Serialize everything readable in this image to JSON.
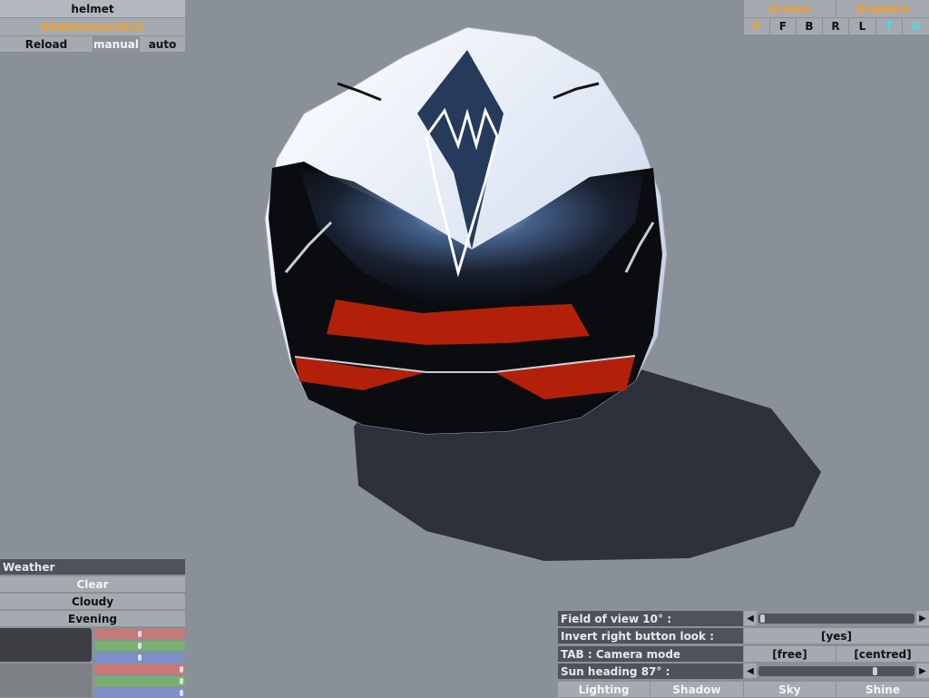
{
  "top_left": {
    "object_label": "helmet",
    "skin_name": "KRäikkönen2012",
    "reload_label": "Reload",
    "manual_label": "manual",
    "auto_label": "auto"
  },
  "top_right": {
    "screen_label": "Screen",
    "graphics_label": "Graphics",
    "views": [
      "P",
      "F",
      "B",
      "R",
      "L",
      "T",
      "U"
    ]
  },
  "weather": {
    "title": "Weather",
    "options": [
      "Clear",
      "Cloudy",
      "Evening"
    ],
    "color_values": [
      "0",
      "0",
      "0",
      "0",
      "0",
      "0"
    ]
  },
  "camera": {
    "fov_label": "Field of view 10° :",
    "fov_value": "0",
    "invert_label": "Invert right button look :",
    "invert_value": "[yes]",
    "tab_label": "TAB : Camera mode",
    "mode_free": "[free]",
    "mode_centred": "[centred]",
    "sun_label": "Sun heading 87° :",
    "sun_value": "0"
  },
  "bottom_tabs": [
    "Lighting",
    "Shadow",
    "Sky",
    "Shine"
  ],
  "colors": {
    "background": "#8a9098",
    "button": "#a5aab0",
    "dark_label": "#4e525a",
    "orange_accent": "#f0a02a",
    "cyan_accent": "#3fe0e8",
    "red_slider": "#c97878",
    "green_slider": "#78b070",
    "blue_slider": "#7d8fc8"
  }
}
